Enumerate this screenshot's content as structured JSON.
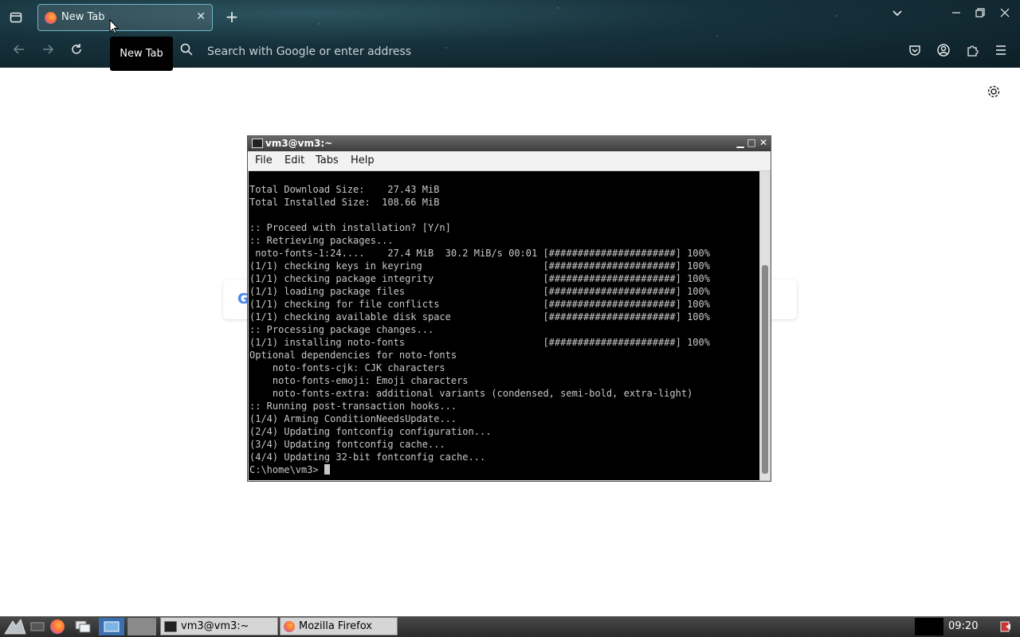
{
  "browser": {
    "tab": {
      "title": "New Tab",
      "close_glyph": "✕"
    },
    "tooltip": "New Tab",
    "urlbar": {
      "placeholder": "Search with Google or enter address"
    }
  },
  "terminal": {
    "title": "vm3@vm3:~",
    "menu": [
      "File",
      "Edit",
      "Tabs",
      "Help"
    ],
    "lines": [
      "Total Download Size:    27.43 MiB",
      "Total Installed Size:  108.66 MiB",
      "",
      ":: Proceed with installation? [Y/n]",
      ":: Retrieving packages...",
      " noto-fonts-1:24....    27.4 MiB  30.2 MiB/s 00:01 [######################] 100%",
      "(1/1) checking keys in keyring                     [######################] 100%",
      "(1/1) checking package integrity                   [######################] 100%",
      "(1/1) loading package files                        [######################] 100%",
      "(1/1) checking for file conflicts                  [######################] 100%",
      "(1/1) checking available disk space                [######################] 100%",
      ":: Processing package changes...",
      "(1/1) installing noto-fonts                        [######################] 100%",
      "Optional dependencies for noto-fonts",
      "    noto-fonts-cjk: CJK characters",
      "    noto-fonts-emoji: Emoji characters",
      "    noto-fonts-extra: additional variants (condensed, semi-bold, extra-light)",
      ":: Running post-transaction hooks...",
      "(1/4) Arming ConditionNeedsUpdate...",
      "(2/4) Updating fontconfig configuration...",
      "(3/4) Updating fontconfig cache...",
      "(4/4) Updating 32-bit fontconfig cache..."
    ],
    "prompt": "C:\\home\\vm3> "
  },
  "taskbar": {
    "tasks": [
      "vm3@vm3:~",
      "Mozilla Firefox"
    ],
    "clock": "09:20"
  }
}
